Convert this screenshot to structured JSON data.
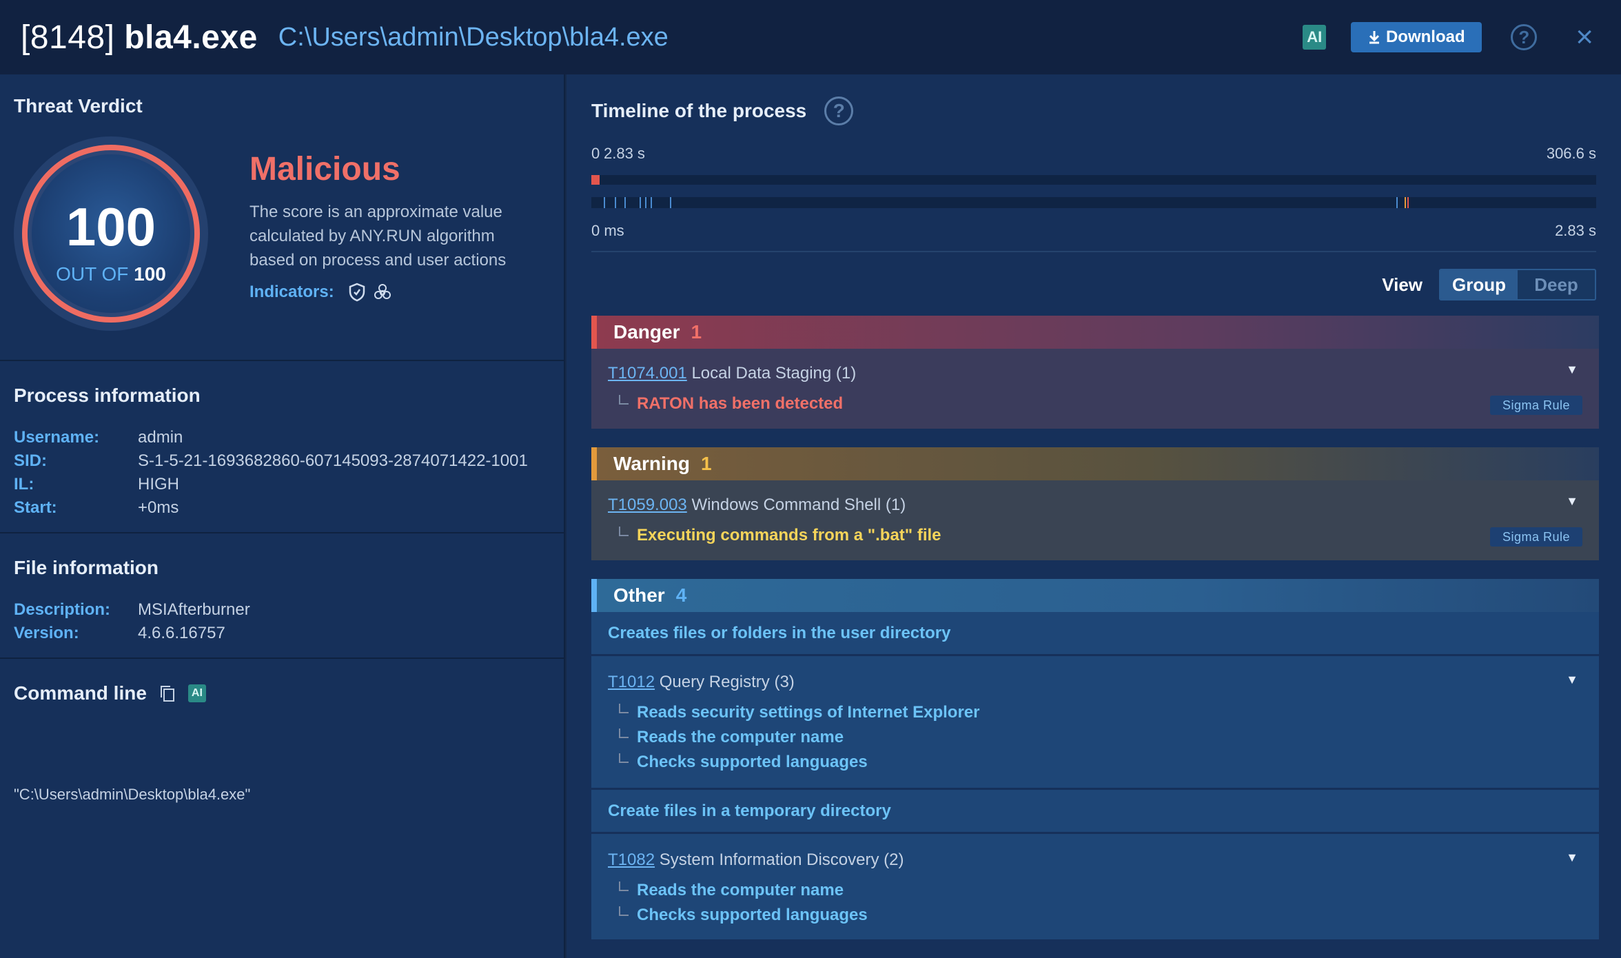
{
  "header": {
    "pid": "[8148]",
    "name": "bla4.exe",
    "path": "C:\\Users\\admin\\Desktop\\bla4.exe",
    "ai_label": "AI",
    "download_label": "Download",
    "help_icon": "?",
    "close_icon": "×"
  },
  "verdict": {
    "section_title": "Threat Verdict",
    "score": "100",
    "out_of_prefix": "OUT OF",
    "out_of_value": "100",
    "verdict": "Malicious",
    "description": "The score is an approximate value calculated by ANY.RUN algorithm based on process and user actions",
    "indicators_label": "Indicators:",
    "indicator_icons": [
      "shield-icon",
      "biohazard-icon"
    ]
  },
  "process_info": {
    "title": "Process information",
    "rows": [
      {
        "key": "Username:",
        "value": "admin"
      },
      {
        "key": "SID:",
        "value": "S-1-5-21-1693682860-607145093-2874071422-1001"
      },
      {
        "key": "IL:",
        "value": "HIGH"
      },
      {
        "key": "Start:",
        "value": "+0ms"
      }
    ]
  },
  "file_info": {
    "title": "File information",
    "rows": [
      {
        "key": "Description:",
        "value": "MSIAfterburner"
      },
      {
        "key": "Version:",
        "value": "4.6.6.16757"
      }
    ]
  },
  "command_line": {
    "title": "Command line",
    "ai_label": "AI",
    "value": "\"C:\\Users\\admin\\Desktop\\bla4.exe\""
  },
  "timeline": {
    "title": "Timeline of the process",
    "top_left": "0",
    "top_marker": "2.83 s",
    "top_right": "306.6 s",
    "bottom_left": "0 ms",
    "bottom_right": "2.83 s",
    "colors": {
      "danger": "#e2564e",
      "tick": "#4a8bd0",
      "warn": "#e39a3c"
    }
  },
  "view": {
    "label": "View",
    "options": [
      "Group",
      "Deep"
    ],
    "selected": "Group"
  },
  "categories": {
    "danger": {
      "label": "Danger",
      "count": "1",
      "technique_id": "T1074.001",
      "technique_name": "Local Data Staging (1)",
      "detail": "RATON has been detected",
      "badge": "Sigma Rule"
    },
    "warning": {
      "label": "Warning",
      "count": "1",
      "technique_id": "T1059.003",
      "technique_name": "Windows Command Shell (1)",
      "detail": "Executing commands from a \".bat\" file",
      "badge": "Sigma Rule"
    },
    "other": {
      "label": "Other",
      "count": "4",
      "plain1": "Creates files or folders in the user directory",
      "t1012_id": "T1012",
      "t1012_name": "Query Registry (3)",
      "t1012_details": [
        "Reads security settings of Internet Explorer",
        "Reads the computer name",
        "Checks supported languages"
      ],
      "plain2": "Create files in a temporary directory",
      "t1082_id": "T1082",
      "t1082_name": "System Information Discovery (2)",
      "t1082_details": [
        "Reads the computer name",
        "Checks supported languages"
      ]
    }
  }
}
